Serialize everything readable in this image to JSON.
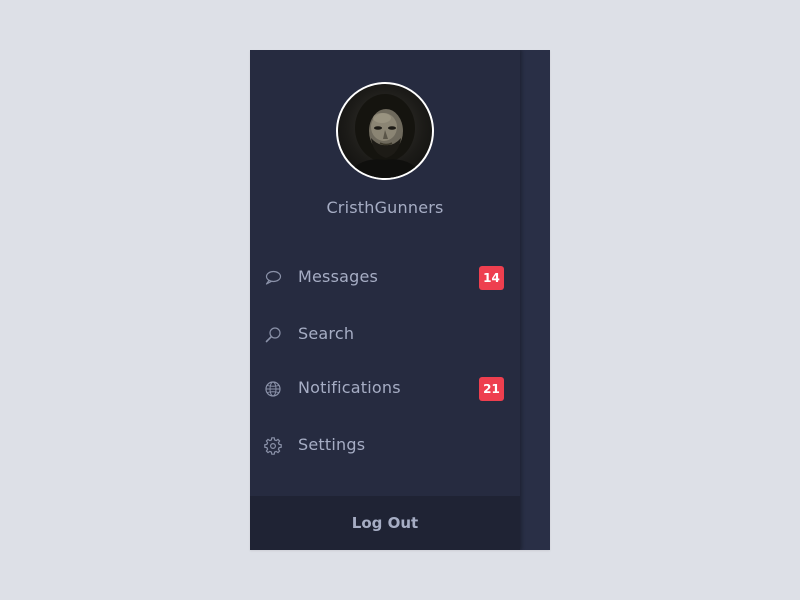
{
  "profile": {
    "username": "CristhGunners",
    "avatar_alt": "user avatar"
  },
  "menu": {
    "items": [
      {
        "label": "Messages",
        "icon": "speech-bubble-icon",
        "badge": "14"
      },
      {
        "label": "Search",
        "icon": "search-icon",
        "badge": null
      },
      {
        "label": "Notifications",
        "icon": "globe-icon",
        "badge": "21"
      },
      {
        "label": "Settings",
        "icon": "gear-icon",
        "badge": null
      }
    ]
  },
  "footer": {
    "logout_label": "Log Out"
  },
  "colors": {
    "page_background": "#dde0e7",
    "sidebar_background": "#262b40",
    "logout_background": "#1f2334",
    "text": "#a6adc4",
    "badge": "#ee3f4f"
  }
}
